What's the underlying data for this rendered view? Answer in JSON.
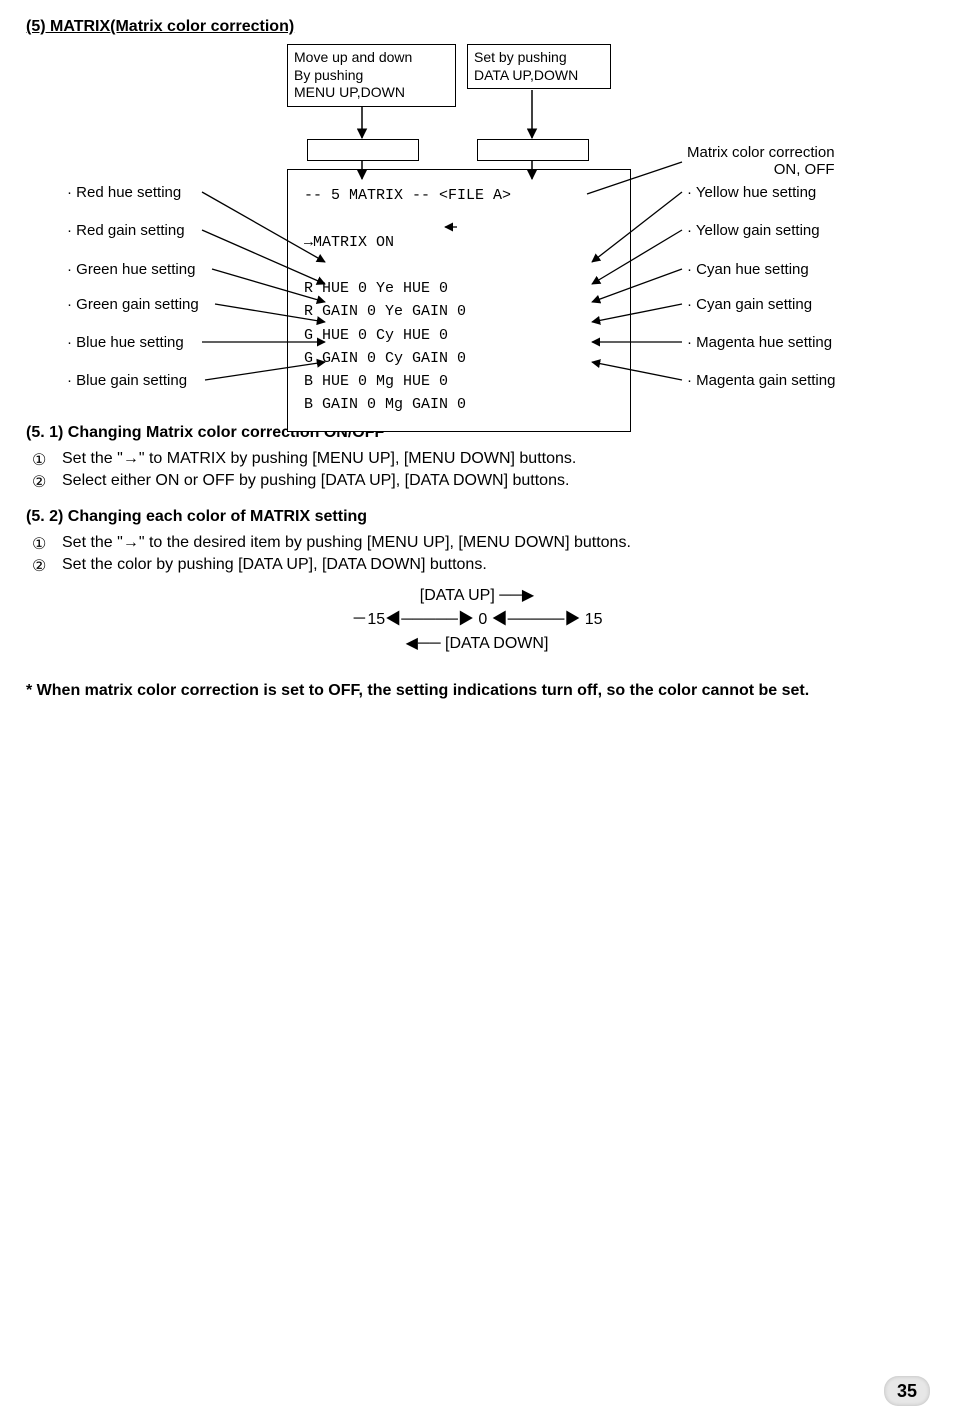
{
  "section_title": "(5)  MATRIX(Matrix color correction)",
  "hints": {
    "menu": "Move up and down\nBy pushing\nMENU UP,DOWN",
    "data": "Set by pushing\nDATA UP,DOWN"
  },
  "left_labels": [
    "· Red hue setting",
    "· Red gain setting",
    "· Green hue setting",
    "· Green gain setting",
    "· Blue hue setting",
    "· Blue gain setting"
  ],
  "right_labels": [
    "Matrix color correction\nON, OFF",
    "· Yellow hue setting",
    "· Yellow gain setting",
    "· Cyan hue setting",
    "· Cyan gain setting",
    "· Magenta hue setting",
    "· Magenta gain setting"
  ],
  "screen": "--  5  MATRIX --    <FILE A>\n\n   →MATRIX    ON\n\n    R HUE     0    Ye HUE    0\n    R GAIN    0    Ye GAIN   0\n    G HUE     0    Cy HUE    0\n    G GAIN    0    Cy GAIN   0\n    B HUE     0    Mg HUE    0\n    B GAIN    0    Mg GAIN   0",
  "subsec1": {
    "title": "(5. 1)  Changing Matrix color correction ON/OFF",
    "steps": [
      "Set the \"→\" to MATRIX by pushing [MENU UP], [MENU DOWN] buttons.",
      "Select either ON or OFF by pushing [DATA UP], [DATA DOWN] buttons."
    ]
  },
  "subsec2": {
    "title": "(5. 2)  Changing each color of MATRIX setting",
    "steps": [
      "Set the \"→\" to the desired item by pushing [MENU UP], [MENU DOWN] buttons.",
      "Set the color by pushing [DATA UP], [DATA DOWN] buttons."
    ]
  },
  "range": {
    "up": "[DATA UP]  ──▶",
    "scale": "－15◀─────▶ 0 ◀─────▶ 15",
    "down": "◀── [DATA DOWN]"
  },
  "note": "* When matrix color correction is set to OFF, the setting indications turn off, so the color cannot be set.",
  "page": "35"
}
